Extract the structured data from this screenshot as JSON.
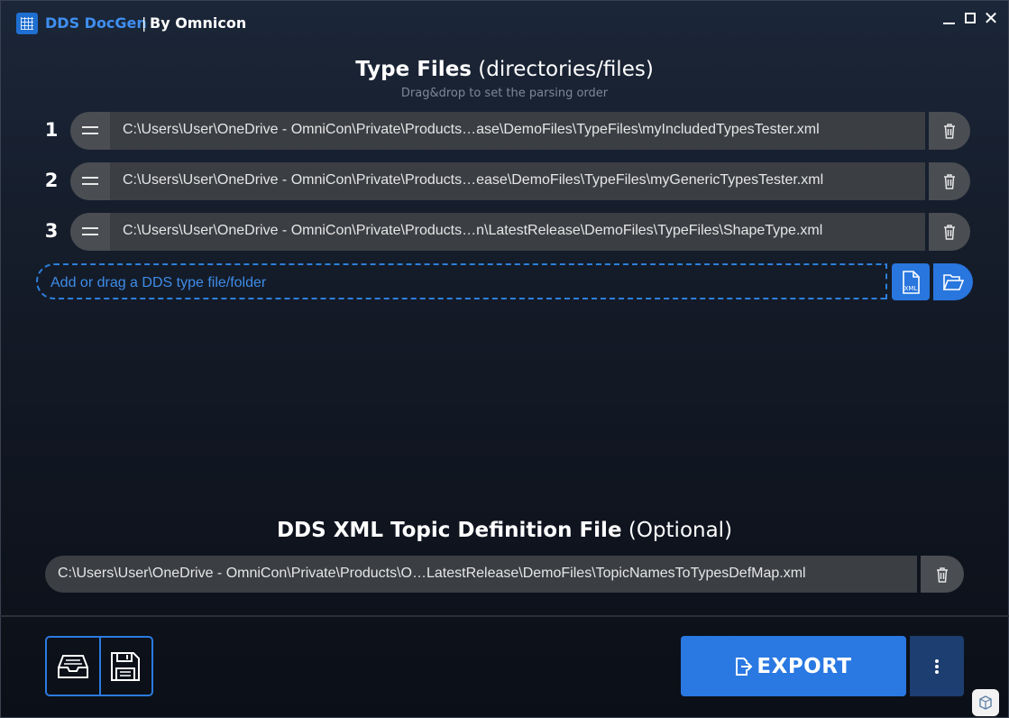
{
  "titlebar": {
    "app_name": "DDS DocGen",
    "separator": "|",
    "by_label": "By Omnicon",
    "icons": [
      "app-logo-icon",
      "minimize-icon",
      "maximize-icon",
      "close-icon"
    ]
  },
  "type_files": {
    "title_bold": "Type Files",
    "title_light": "(directories/files)",
    "hint": "Drag&drop to set the parsing order",
    "rows": [
      {
        "index": "1",
        "path": "C:\\Users\\User\\OneDrive - OmniCon\\Private\\Products…ase\\DemoFiles\\TypeFiles\\myIncludedTypesTester.xml"
      },
      {
        "index": "2",
        "path": "C:\\Users\\User\\OneDrive - OmniCon\\Private\\Products…ease\\DemoFiles\\TypeFiles\\myGenericTypesTester.xml"
      },
      {
        "index": "3",
        "path": "C:\\Users\\User\\OneDrive - OmniCon\\Private\\Products…n\\LatestRelease\\DemoFiles\\TypeFiles\\ShapeType.xml"
      }
    ],
    "add_placeholder": "Add or drag a DDS type file/folder",
    "add_file_icon": "xml-file-icon",
    "add_folder_icon": "folder-open-icon",
    "xml_badge": "XML"
  },
  "topic_file": {
    "title_bold": "DDS XML Topic Definition File",
    "title_light": "(Optional)",
    "path": "C:\\Users\\User\\OneDrive - OmniCon\\Private\\Products\\O…LatestRelease\\DemoFiles\\TopicNamesToTypesDefMap.xml"
  },
  "footer": {
    "open_icon": "inbox-tray-icon",
    "save_icon": "floppy-disk-icon",
    "export_label": "EXPORT",
    "export_icon": "file-export-icon",
    "more_icon": "kebab-menu-icon",
    "badge_icon": "omnicon-badge-icon"
  },
  "colors": {
    "accent": "#2a78e2",
    "title_blue": "#3f8ff0",
    "row_bg": "#3b3e43",
    "handle_bg": "#4a4d52",
    "more_bg": "#1c3e70",
    "hint": "#7d8797"
  }
}
